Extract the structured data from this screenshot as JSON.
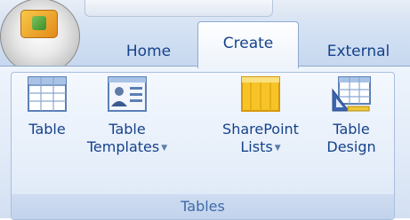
{
  "tabs": {
    "home": "Home",
    "create": "Create",
    "external": "External"
  },
  "group": {
    "label": "Tables"
  },
  "commands": {
    "table": {
      "line1": "Table",
      "line2": ""
    },
    "templates": {
      "line1": "Table",
      "line2": "Templates"
    },
    "sharepoint": {
      "line1": "SharePoint",
      "line2": "Lists"
    },
    "design": {
      "line1": "Table",
      "line2": "Design"
    }
  },
  "colors": {
    "tab_text": "#15428b",
    "group_label_text": "#3e6aaa",
    "ribbon_bg": "#e2ebf8",
    "sharepoint_icon": "#f7c428"
  },
  "icons": {
    "office_button": "office-logo-icon",
    "table": "table-grid-icon",
    "templates": "table-templates-icon",
    "sharepoint": "sharepoint-list-icon",
    "design": "table-design-icon",
    "dropdown": "dropdown-arrow-icon"
  }
}
